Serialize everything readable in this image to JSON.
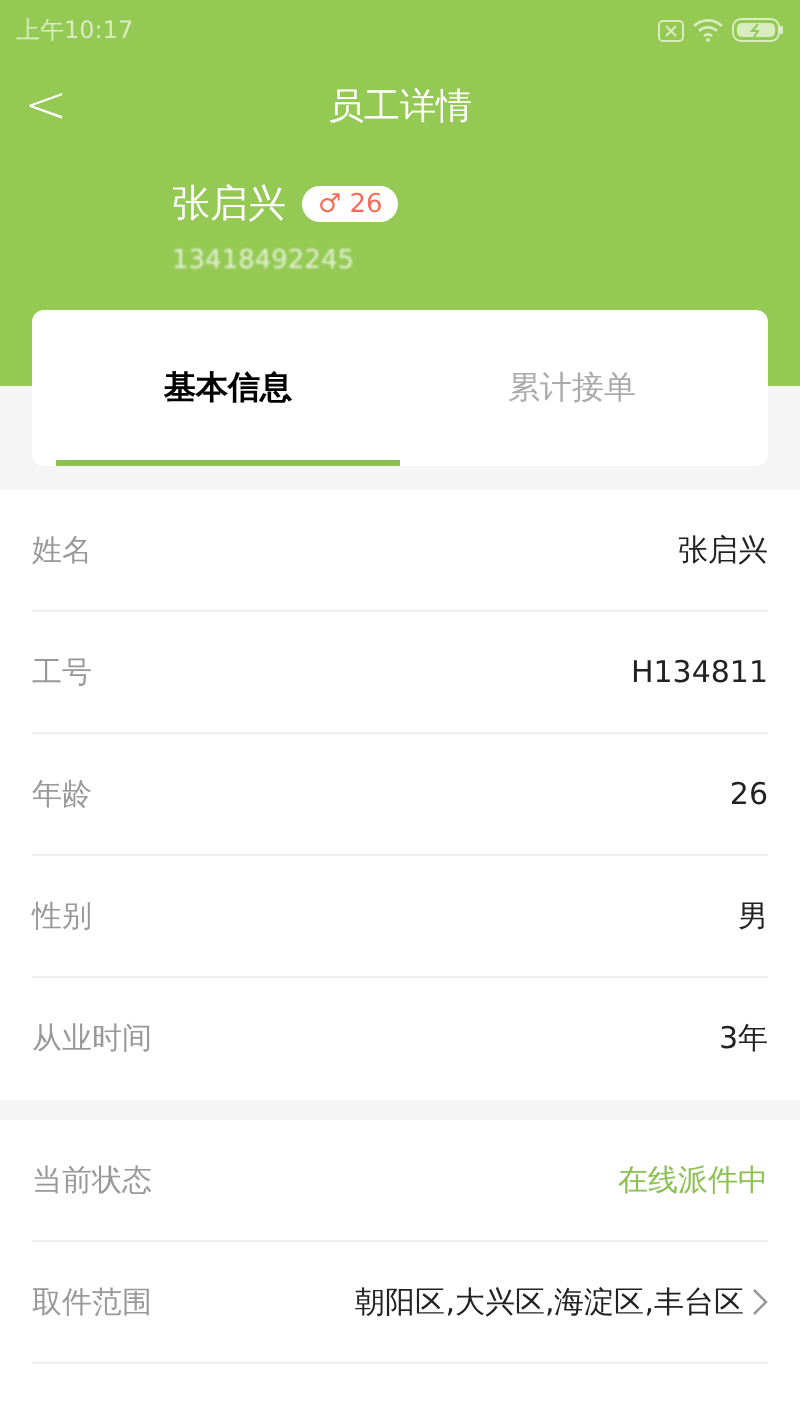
{
  "status_bar": {
    "time": "上午10:17"
  },
  "header": {
    "back": "<",
    "title": "员工详情"
  },
  "profile": {
    "name": "张启兴",
    "gender_symbol": "♂",
    "age": "26",
    "phone": "13418492245"
  },
  "tabs": [
    {
      "label": "基本信息",
      "selected": true
    },
    {
      "label": "累计接单",
      "selected": false
    }
  ],
  "basic_info": [
    {
      "label": "姓名",
      "value": "张启兴"
    },
    {
      "label": "工号",
      "value": "H134811"
    },
    {
      "label": "年龄",
      "value": "26"
    },
    {
      "label": "性别",
      "value": "男"
    },
    {
      "label": "从业时间",
      "value": "3年"
    }
  ],
  "work_info": [
    {
      "label": "当前状态",
      "value": "在线派件中",
      "kind": "status"
    },
    {
      "label": "取件范围",
      "value": "朝阳区,大兴区,海淀区,丰台区",
      "kind": "link"
    }
  ]
}
